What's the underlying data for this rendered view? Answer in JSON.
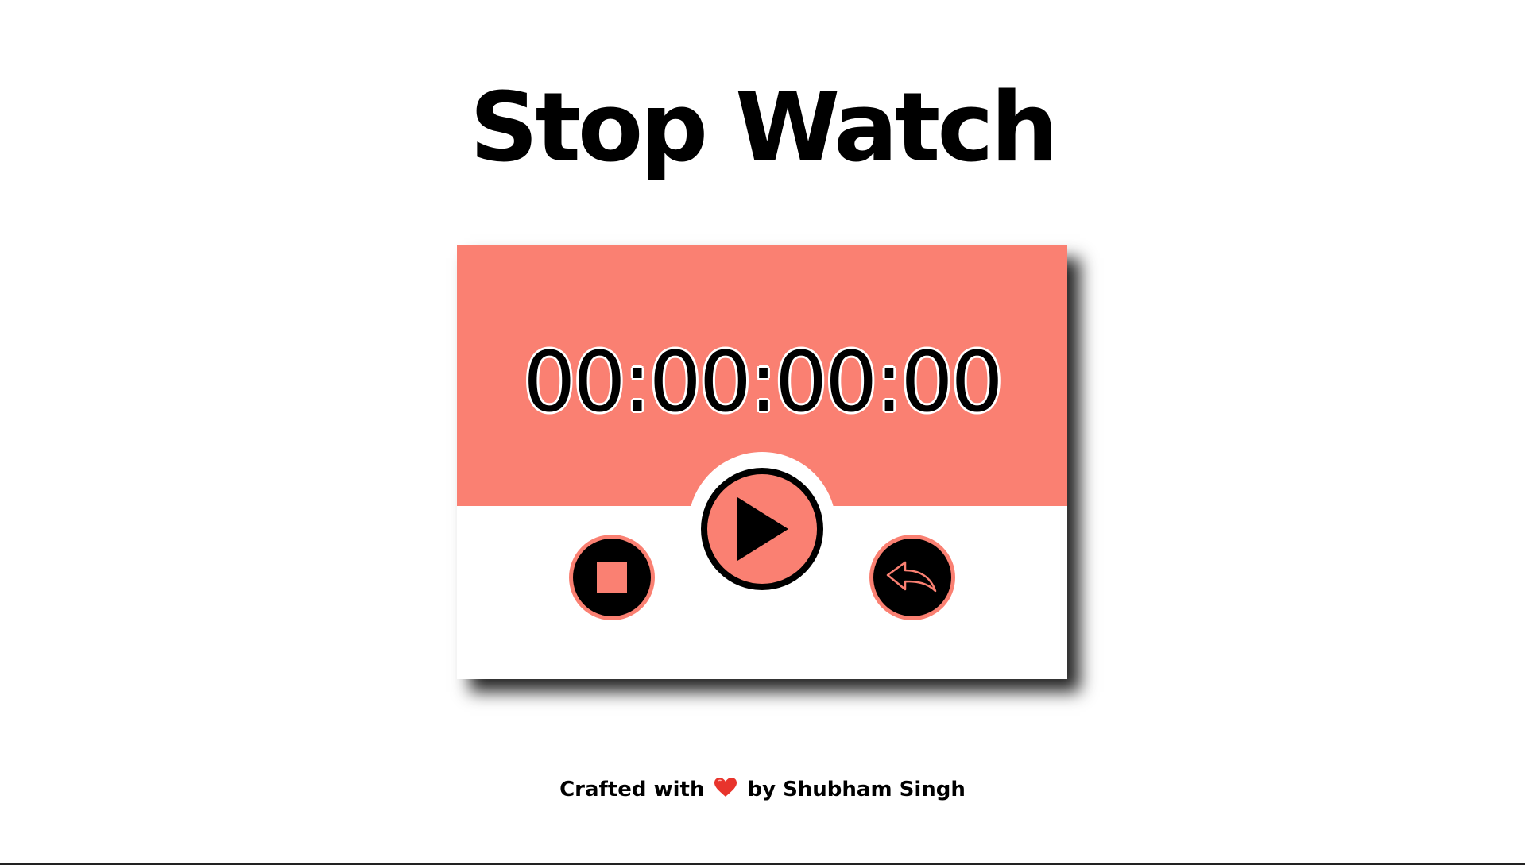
{
  "app": {
    "title": "Stop Watch"
  },
  "stopwatch": {
    "time_display": "00:00:00:00",
    "buttons": {
      "play": {
        "icon": "play-icon"
      },
      "stop": {
        "icon": "stop-icon"
      },
      "reset": {
        "icon": "reply-icon"
      }
    }
  },
  "footer": {
    "prefix": "Crafted with",
    "heart_icon": "heart-icon",
    "suffix": "by Shubham Singh"
  },
  "colors": {
    "accent": "#fa8072",
    "background": "#ffffff",
    "dark": "#000000",
    "heart": "#e8342c"
  }
}
